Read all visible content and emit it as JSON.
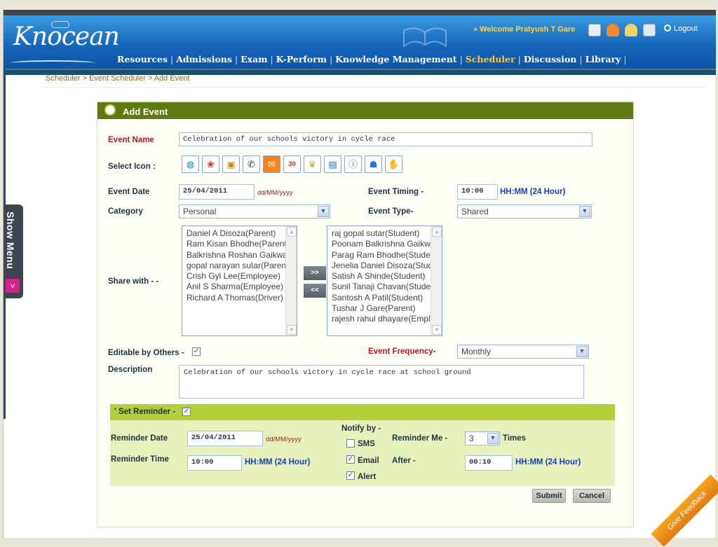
{
  "header": {
    "logo": "Knocean",
    "welcome": "» Welcome Pratyush T Gare",
    "logout": "Logout",
    "nav": [
      "Resources",
      "Admissions",
      "Exam",
      "K-Perform",
      "Knowledge Management",
      "Scheduler",
      "Discussion",
      "Library"
    ],
    "active_nav": "Scheduler"
  },
  "breadcrumb": "Scheduler > Event Scheduler > Add Event",
  "side_menu": {
    "label": "Show Menu",
    "arrow": ">"
  },
  "form": {
    "title": "Add Event",
    "event_name_label": "Event Name",
    "event_name_value": "Celebration of our schools victory in cycle race",
    "select_icon_label": "Select Icon :",
    "icons": [
      "globe-icon",
      "gift-icon",
      "package-icon",
      "phone-icon",
      "mail-icon",
      "calendar-icon",
      "trophy-icon",
      "window-icon",
      "info-icon",
      "group-icon",
      "handshake-icon"
    ],
    "event_date_label": "Event Date",
    "event_date_value": "25/04/2011",
    "date_format_hint": "dd/MM/yyyy",
    "event_timing_label": "Event Timing -",
    "event_timing_value": "10:00",
    "time_format_hint": "HH:MM (24 Hour)",
    "category_label": "Category",
    "category_value": "Personal",
    "event_type_label": "Event Type-",
    "event_type_value": "Shared",
    "share_with_label": "Share with - -",
    "available_list": [
      "Daniel A Disoza(Parent)",
      "Ram Kisan Bhodhe(Parent)",
      "Balkrishna Roshan Gaikwad",
      "gopal narayan sutar(Parent)",
      "Crish Gyl Lee(Employee)",
      "Anil S Sharma(Employee)",
      "Richard A Thomas(Driver)"
    ],
    "selected_list": [
      "raj gopal sutar(Student)",
      "Poonam Balkrishna Gaikwad",
      "Parag Ram Bhodhe(Student)",
      "Jenelia Daniel Disoza(Student)",
      "Satish A Shinde(Student)",
      "Sunil Tanaji Chavan(Student)",
      "Santosh A Patil(Student)",
      "Tushar J Gare(Parent)",
      "rajesh rahul dhayare(Employee)"
    ],
    "move_right": ">>",
    "move_left": "<<",
    "editable_label": "Editable by Others -",
    "editable_checked": "✓",
    "frequency_label": "Event Frequency-",
    "frequency_value": "Monthly",
    "description_label": "Description",
    "description_value": "Celebration of our schools victory in cycle race at school ground"
  },
  "reminder": {
    "header_label": "' Set Reminder -",
    "header_checked": "✓",
    "date_label": "Reminder Date",
    "date_value": "25/04/2011",
    "date_hint": "dd/MM/yyyy",
    "time_label": "Reminder Time",
    "time_value": "10:00",
    "time_hint": "HH:MM (24 Hour)",
    "notify_label": "Notify by -",
    "sms_label": "SMS",
    "email_label": "Email",
    "alert_label": "Alert",
    "email_checked": "✓",
    "alert_checked": "✓",
    "remind_me_label": "Reminder Me -",
    "remind_me_value": "3",
    "times_label": "Times",
    "after_label": "After -",
    "after_value": "00:10",
    "after_hint": "HH:MM (24 Hour)"
  },
  "buttons": {
    "submit": "Submit",
    "cancel": "Cancel"
  },
  "feedback": "Give Feedback"
}
